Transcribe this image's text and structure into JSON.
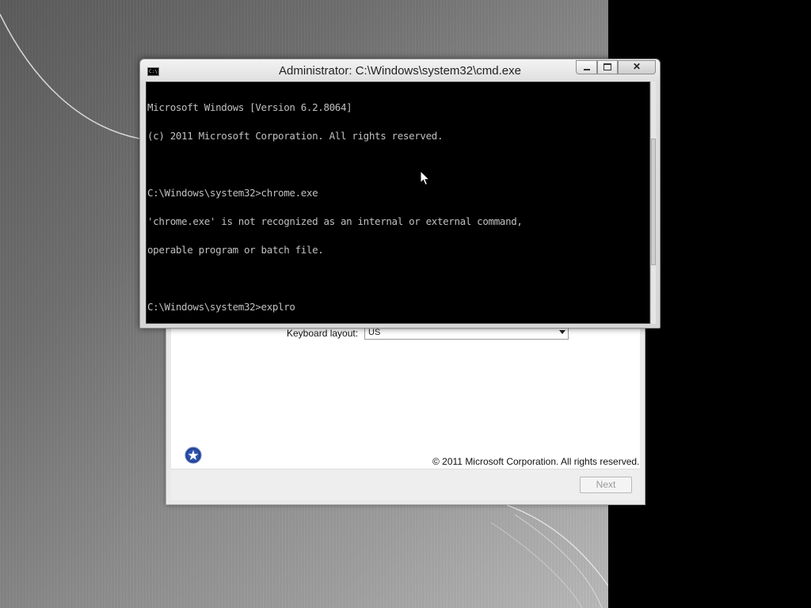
{
  "cmd": {
    "title": "Administrator: C:\\Windows\\system32\\cmd.exe",
    "icon_text": "C:\\",
    "lines": [
      "Microsoft Windows [Version 6.2.8064]",
      "(c) 2011 Microsoft Corporation. All rights reserved.",
      "",
      "C:\\Windows\\system32>chrome.exe",
      "'chrome.exe' is not recognized as an internal or external command,",
      "operable program or batch file.",
      "",
      "C:\\Windows\\system32>explro"
    ],
    "buttons": {
      "close": "✕"
    }
  },
  "setup": {
    "keyboard_label": "Keyboard layout:",
    "keyboard_value": "US",
    "copyright": "© 2011 Microsoft Corporation. All rights reserved.",
    "next_label": "Next"
  },
  "colors": {
    "console_bg": "#000000",
    "console_text": "#c0c0c0"
  },
  "icons": {
    "cmd_icon": "cmd-icon",
    "setup_logo": "setup-star-icon",
    "cursor": "arrow-cursor"
  }
}
